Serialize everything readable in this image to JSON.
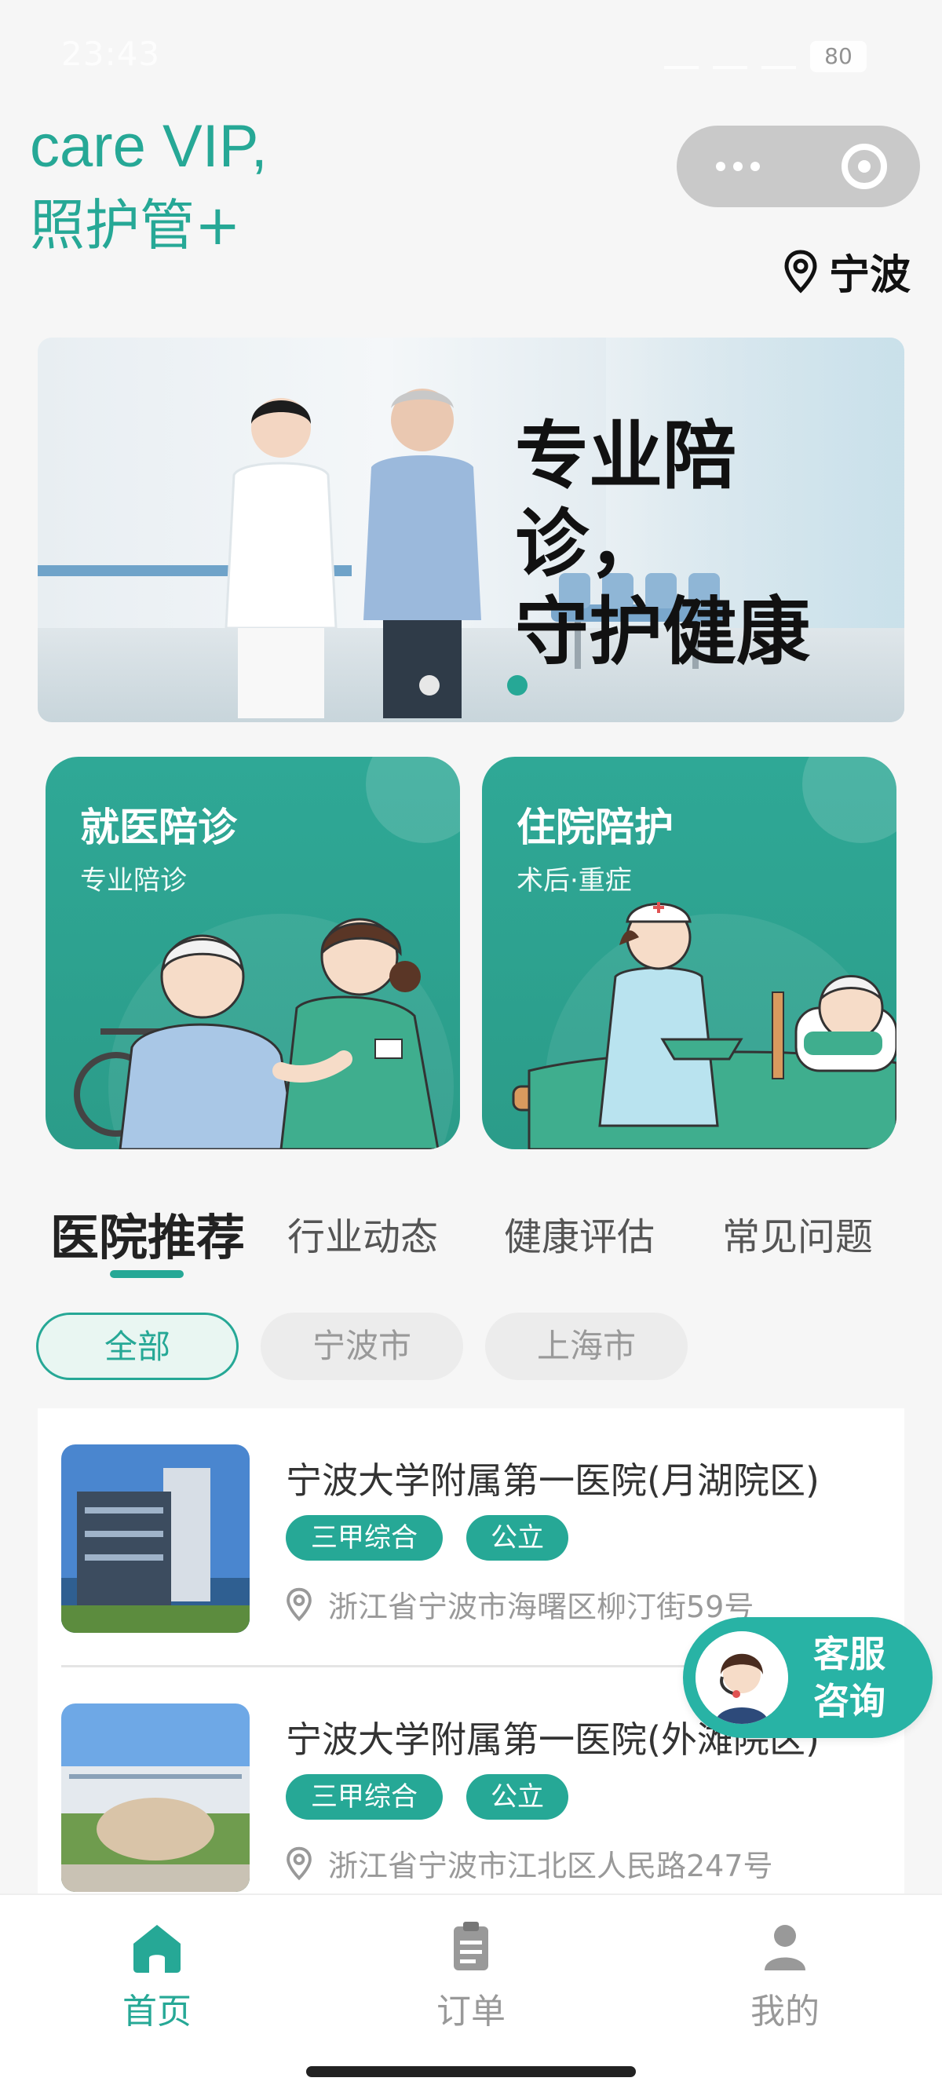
{
  "status_bar": {
    "time": "23:43",
    "battery": "80"
  },
  "header": {
    "brand_line1": "care VIP,",
    "brand_line2": "照护管+",
    "city": "宁波"
  },
  "banner": {
    "headline_line1": "专业陪诊，",
    "headline_line2": "守护健康",
    "slide_count": 2,
    "active_slide": 2
  },
  "services": [
    {
      "title": "就医陪诊",
      "subtitle": "专业陪诊"
    },
    {
      "title": "住院陪护",
      "subtitle": "术后·重症"
    }
  ],
  "tabs": [
    "医院推荐",
    "行业动态",
    "健康评估",
    "常见问题"
  ],
  "filters": [
    "全部",
    "宁波市",
    "上海市"
  ],
  "hospitals": [
    {
      "name": "宁波大学附属第一医院(月湖院区)",
      "tags": [
        "三甲综合",
        "公立"
      ],
      "address": "浙江省宁波市海曙区柳汀街59号"
    },
    {
      "name": "宁波大学附属第一医院(外滩院区)",
      "tags": [
        "三甲综合",
        "公立"
      ],
      "address": "浙江省宁波市江北区人民路247号"
    }
  ],
  "support": {
    "line1": "客服",
    "line2": "咨询"
  },
  "bottom_nav": [
    {
      "label": "首页",
      "icon": "home-icon"
    },
    {
      "label": "订单",
      "icon": "clipboard-icon"
    },
    {
      "label": "我的",
      "icon": "user-icon"
    }
  ],
  "colors": {
    "accent": "#26a896",
    "background": "#f6f6f6"
  }
}
